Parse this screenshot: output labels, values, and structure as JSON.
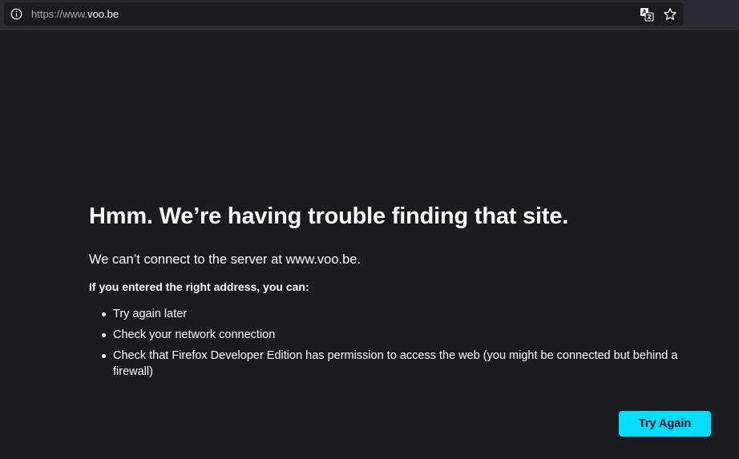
{
  "urlbar": {
    "url_scheme": "https://www.",
    "url_domain": "voo.be",
    "info_icon": "info-icon",
    "translate_icon": "translate-icon",
    "bookmark_icon": "star-icon"
  },
  "error_page": {
    "title": "Hmm. We’re having trouble finding that site.",
    "description": "We can’t connect to the server at www.voo.be.",
    "subheading": "If you entered the right address, you can:",
    "tips": [
      "Try again later",
      "Check your network connection",
      "Check that Firefox Developer Edition has permission to access the web (you might be connected but behind a firewall)"
    ],
    "button_label": "Try Again"
  },
  "colors": {
    "background": "#1c1b22",
    "toolbar": "#2b2a33",
    "accent": "#00ddff"
  }
}
